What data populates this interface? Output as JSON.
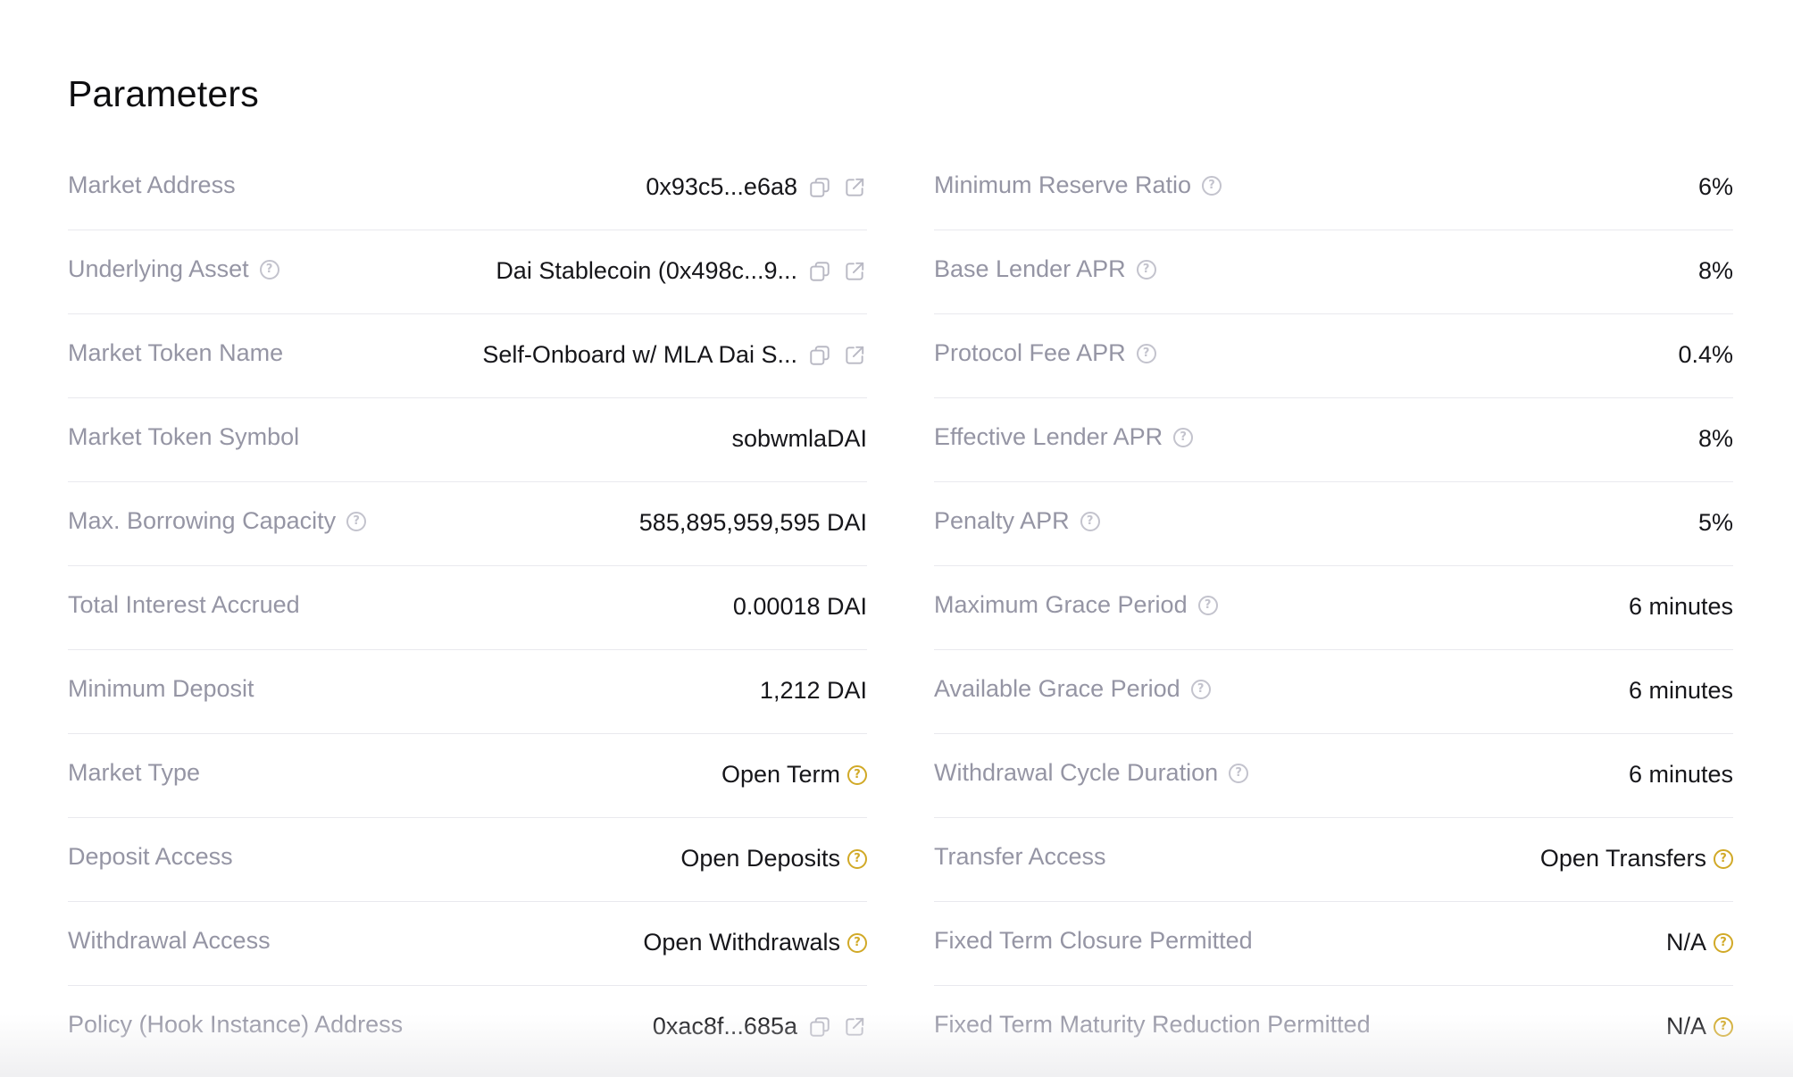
{
  "title": "Parameters",
  "left": [
    {
      "label": "Market Address",
      "value": "0x93c5...e6a8",
      "help": false,
      "value_help": false,
      "copy": true,
      "link": true
    },
    {
      "label": "Underlying Asset",
      "value": "Dai Stablecoin (0x498c...9...",
      "help": true,
      "value_help": false,
      "copy": true,
      "link": true
    },
    {
      "label": "Market Token Name",
      "value": "Self-Onboard w/ MLA Dai S...",
      "help": false,
      "value_help": false,
      "copy": true,
      "link": true
    },
    {
      "label": "Market Token Symbol",
      "value": "sobwmlaDAI",
      "help": false,
      "value_help": false,
      "copy": false,
      "link": false
    },
    {
      "label": "Max. Borrowing Capacity",
      "value": "585,895,959,595 DAI",
      "help": true,
      "value_help": false,
      "copy": false,
      "link": false
    },
    {
      "label": "Total Interest Accrued",
      "value": "0.00018 DAI",
      "help": false,
      "value_help": false,
      "copy": false,
      "link": false
    },
    {
      "label": "Minimum Deposit",
      "value": "1,212 DAI",
      "help": false,
      "value_help": false,
      "copy": false,
      "link": false
    },
    {
      "label": "Market Type",
      "value": "Open Term",
      "help": false,
      "value_help": true,
      "copy": false,
      "link": false
    },
    {
      "label": "Deposit Access",
      "value": "Open Deposits",
      "help": false,
      "value_help": true,
      "copy": false,
      "link": false
    },
    {
      "label": "Withdrawal Access",
      "value": "Open Withdrawals",
      "help": false,
      "value_help": true,
      "copy": false,
      "link": false
    },
    {
      "label": "Policy (Hook Instance) Address",
      "value": "0xac8f...685a",
      "help": false,
      "value_help": false,
      "copy": true,
      "link": true
    }
  ],
  "right": [
    {
      "label": "Minimum Reserve Ratio",
      "value": "6%",
      "help": true,
      "value_help": false
    },
    {
      "label": "Base Lender APR",
      "value": "8%",
      "help": true,
      "value_help": false
    },
    {
      "label": "Protocol Fee APR",
      "value": "0.4%",
      "help": true,
      "value_help": false
    },
    {
      "label": "Effective Lender APR",
      "value": "8%",
      "help": true,
      "value_help": false
    },
    {
      "label": "Penalty APR",
      "value": "5%",
      "help": true,
      "value_help": false
    },
    {
      "label": "Maximum Grace Period",
      "value": "6 minutes",
      "help": true,
      "value_help": false
    },
    {
      "label": "Available Grace Period",
      "value": "6 minutes",
      "help": true,
      "value_help": false
    },
    {
      "label": "Withdrawal Cycle Duration",
      "value": "6 minutes",
      "help": true,
      "value_help": false
    },
    {
      "label": "Transfer Access",
      "value": "Open Transfers",
      "help": false,
      "value_help": true
    },
    {
      "label": "Fixed Term Closure Permitted",
      "value": "N/A",
      "help": false,
      "value_help": true
    },
    {
      "label": "Fixed Term Maturity Reduction Permitted",
      "value": "N/A",
      "help": false,
      "value_help": true
    }
  ],
  "icons": {
    "help": "question-circle-icon",
    "copy": "copy-icon",
    "link": "external-link-icon",
    "help_glyph": "?"
  },
  "colors": {
    "label": "#9595a4",
    "value": "#16161a",
    "divider": "#e9e9ee",
    "help_gray": "#c3c3cd",
    "help_gold": "#d1a927"
  }
}
